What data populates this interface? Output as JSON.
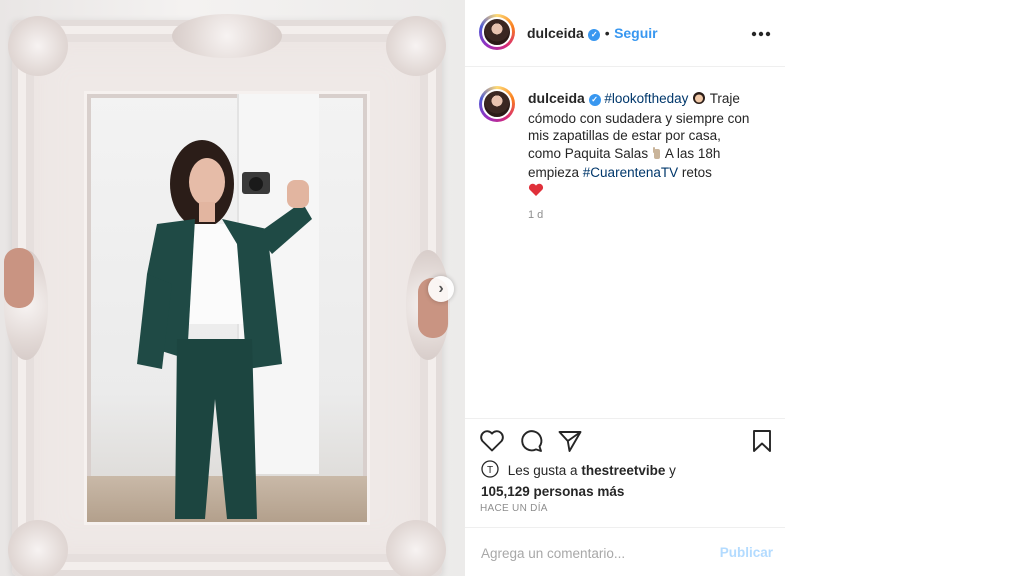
{
  "post": {
    "username": "dulceida",
    "verified_mark": "✓",
    "separator": "•",
    "follow_label": "Seguir",
    "more_label": "•••",
    "caption_user": "dulceida",
    "hashtag_1": "#lookoftheday",
    "caption_part_1": "Traje cómodo con sudadera y siempre con mis zapatillas de estar por casa, como Paquita Salas",
    "caption_part_2": "A las 18h empieza",
    "hashtag_2": "#CuarentenaTV",
    "caption_part_3": "retos",
    "time_ago": "1 d",
    "likes_prefix": "Les gusta a",
    "likes_user": "thestreetvibe",
    "likes_connector": "y",
    "likes_count": "105,129 personas más",
    "posted_when": "HACE UN DÍA",
    "comment_placeholder": "Agrega un comentario...",
    "publish_label": "Publicar"
  },
  "icons": {
    "like": "heart-icon",
    "comment": "comment-icon",
    "share": "share-icon",
    "save": "bookmark-icon",
    "more": "more-options-icon",
    "next": "chevron-right-icon",
    "caption_emoji_1": "woman-emoji",
    "caption_emoji_2": "hand-emoji",
    "caption_emoji_3": "heart-emoji"
  },
  "colors": {
    "link_blue": "#3897f0",
    "hashtag": "#00376b",
    "text": "#262626",
    "muted": "#8e8e8e",
    "publish_disabled": "#b3dbff",
    "heart_red": "#ed4956"
  }
}
